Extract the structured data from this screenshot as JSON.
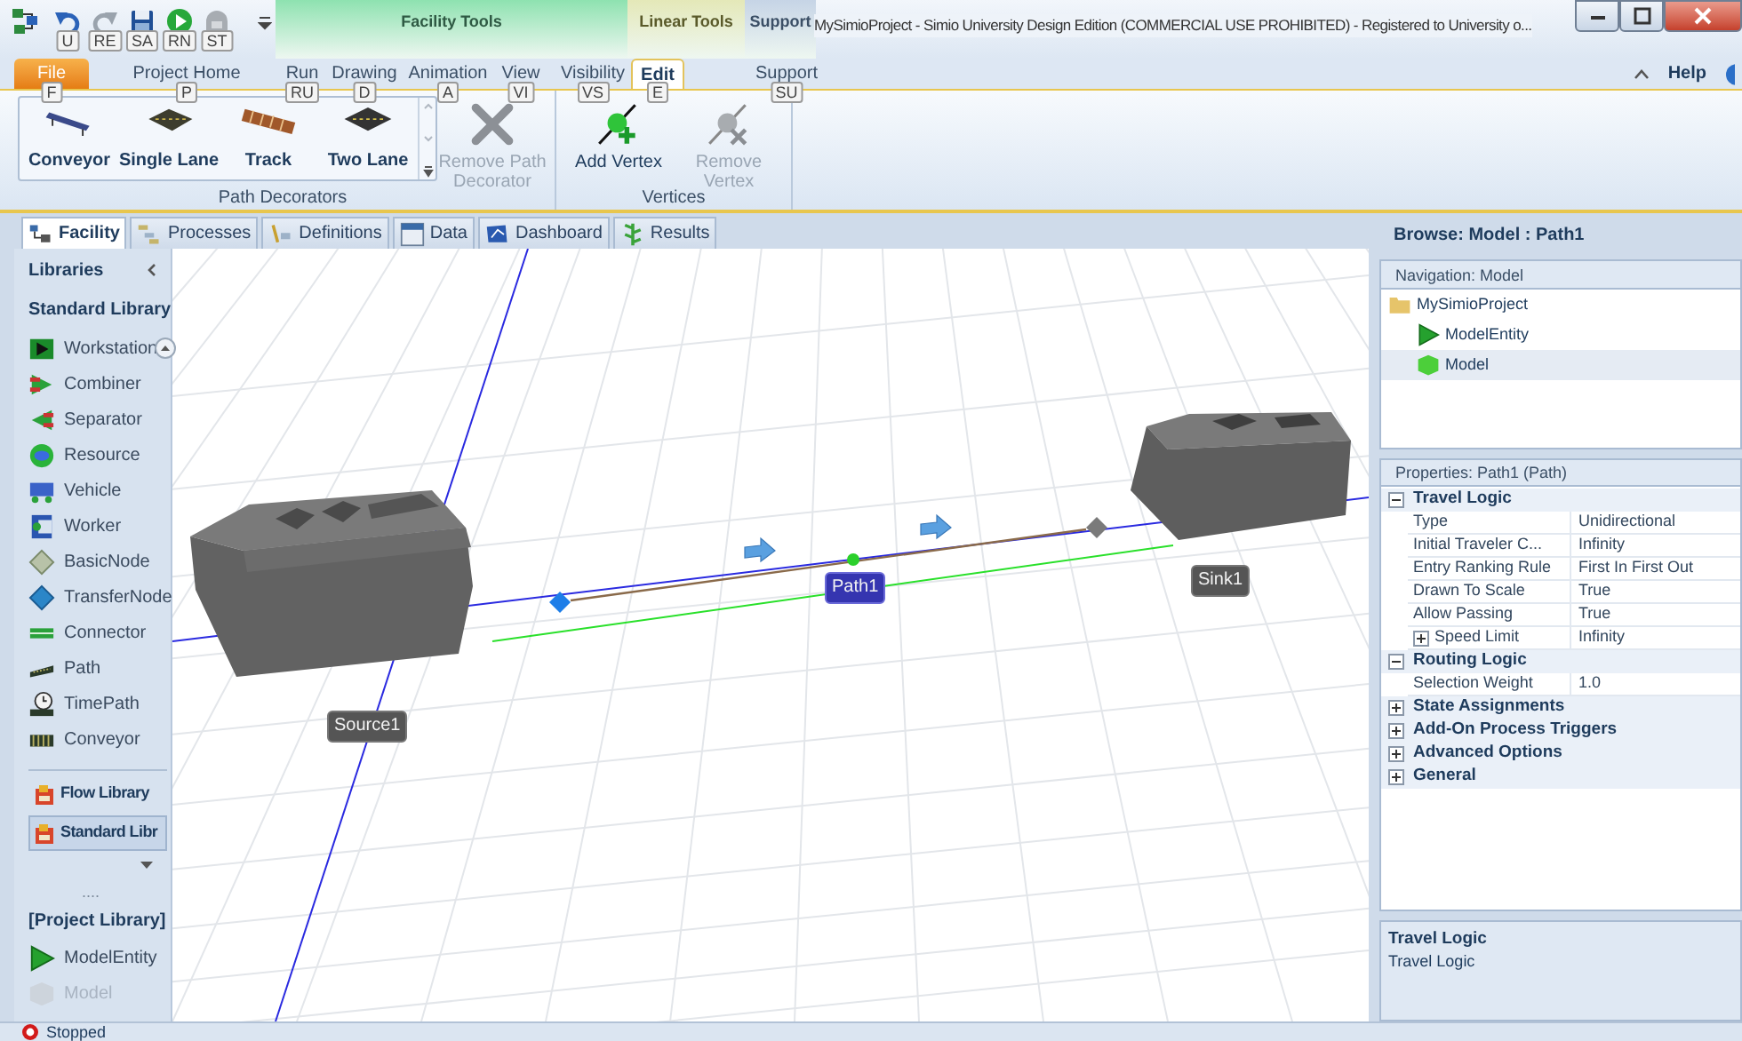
{
  "title_bar": {
    "quick_access": [
      {
        "kind": "undo",
        "key_tip": "U"
      },
      {
        "kind": "redo",
        "key_tip": "RE"
      },
      {
        "kind": "save",
        "key_tip": "SA"
      },
      {
        "kind": "run",
        "key_tip": "RN"
      },
      {
        "kind": "stop",
        "key_tip": "ST"
      }
    ],
    "context_groups": [
      {
        "label": "Facility Tools",
        "color": "#8ee2b0"
      },
      {
        "label": "Linear Tools",
        "color": "#e4e8b8"
      },
      {
        "label": "Support",
        "color": "#c6d4e6"
      }
    ],
    "title": "MySimioProject - Simio University Design Edition (COMMERCIAL USE PROHIBITED) - Registered to University o..."
  },
  "ribbon_tabs": [
    {
      "label": "File",
      "key_tip": "F",
      "kind": "file",
      "selected": false
    },
    {
      "label": "Project Home",
      "key_tip": "P",
      "kind": "tab",
      "selected": false
    },
    {
      "label": "Run",
      "key_tip": "RU",
      "kind": "tab",
      "selected": false
    },
    {
      "label": "Drawing",
      "key_tip": "D",
      "kind": "tab",
      "selected": false
    },
    {
      "label": "Animation",
      "key_tip": "A",
      "kind": "tab",
      "selected": false
    },
    {
      "label": "View",
      "key_tip": "VI",
      "kind": "tab",
      "selected": false
    },
    {
      "label": "Visibility",
      "key_tip": "VS",
      "kind": "tab",
      "selected": false
    },
    {
      "label": "Edit",
      "key_tip": "E",
      "kind": "tab",
      "selected": true
    },
    {
      "label": "Support",
      "key_tip": "SU",
      "kind": "tab",
      "selected": false
    }
  ],
  "help": "Help",
  "ribbon_groups": [
    {
      "label": "Path Decorators",
      "gallery": [
        {
          "label": "Conveyor",
          "kind": "conveyor"
        },
        {
          "label": "Single Lane",
          "kind": "single_lane"
        },
        {
          "label": "Track",
          "kind": "track"
        },
        {
          "label": "Two Lane",
          "kind": "two_lane"
        }
      ],
      "buttons": [
        {
          "label": "Remove Path Decorator",
          "kind": "remove_decorator",
          "disabled": true
        }
      ]
    },
    {
      "label": "Vertices",
      "buttons": [
        {
          "label": "Add Vertex",
          "kind": "add_vertex",
          "disabled": false
        },
        {
          "label": "Remove Vertex",
          "kind": "remove_vertex",
          "disabled": true
        }
      ]
    }
  ],
  "view_tabs": [
    {
      "label": "Facility",
      "kind": "facility",
      "selected": true
    },
    {
      "label": "Processes",
      "kind": "processes",
      "selected": false
    },
    {
      "label": "Definitions",
      "kind": "definitions",
      "selected": false
    },
    {
      "label": "Data",
      "kind": "data",
      "selected": false
    },
    {
      "label": "Dashboard",
      "kind": "dashboard",
      "selected": false
    },
    {
      "label": "Results",
      "kind": "results",
      "selected": false
    }
  ],
  "libraries": {
    "title": "Libraries",
    "heading": "Standard Library",
    "items": [
      {
        "label": "Workstation",
        "kind": "workstation"
      },
      {
        "label": "Combiner",
        "kind": "combiner"
      },
      {
        "label": "Separator",
        "kind": "separator"
      },
      {
        "label": "Resource",
        "kind": "resource"
      },
      {
        "label": "Vehicle",
        "kind": "vehicle"
      },
      {
        "label": "Worker",
        "kind": "worker"
      },
      {
        "label": "BasicNode",
        "kind": "basicnode"
      },
      {
        "label": "TransferNode",
        "kind": "transfernode"
      },
      {
        "label": "Connector",
        "kind": "connector"
      },
      {
        "label": "Path",
        "kind": "path"
      },
      {
        "label": "TimePath",
        "kind": "timepath"
      },
      {
        "label": "Conveyor",
        "kind": "conveyor"
      }
    ],
    "library_buttons": [
      {
        "label": "Flow Library",
        "selected": false
      },
      {
        "label": "Standard Libr",
        "selected": true
      }
    ],
    "more": "....",
    "project_heading": "[Project Library]",
    "project_items": [
      {
        "label": "ModelEntity",
        "kind": "entity",
        "disabled": false
      },
      {
        "label": "Model",
        "kind": "model",
        "disabled": true
      }
    ]
  },
  "canvas": {
    "objects": [
      {
        "label": "Source1",
        "kind": "source",
        "selected": false
      },
      {
        "label": "Path1",
        "kind": "path",
        "selected": true
      },
      {
        "label": "Sink1",
        "kind": "sink",
        "selected": false
      }
    ]
  },
  "browser": {
    "title": "Browse: Model : Path1",
    "navigation": {
      "header": "Navigation: Model",
      "tree": [
        {
          "label": "MySimioProject",
          "kind": "project",
          "selected": false,
          "children": [
            {
              "label": "ModelEntity",
              "kind": "entity",
              "selected": false
            },
            {
              "label": "Model",
              "kind": "model",
              "selected": true
            }
          ]
        }
      ]
    },
    "properties": {
      "header": "Properties: Path1 (Path)",
      "categories": [
        {
          "label": "Travel Logic",
          "expanded": true,
          "rows": [
            {
              "label": "Type",
              "value": "Unidirectional",
              "kind": "value"
            },
            {
              "label": "Initial Traveler C...",
              "value": "Infinity",
              "kind": "value"
            },
            {
              "label": "Entry Ranking Rule",
              "value": "First In First Out",
              "kind": "value"
            },
            {
              "label": "Drawn To Scale",
              "value": "True",
              "kind": "value"
            },
            {
              "label": "Allow Passing",
              "value": "True",
              "kind": "value"
            },
            {
              "label": "Speed Limit",
              "value": "Infinity",
              "kind": "group",
              "expanded": false
            }
          ]
        },
        {
          "label": "Routing Logic",
          "expanded": true,
          "rows": [
            {
              "label": "Selection Weight",
              "value": "1.0",
              "kind": "value"
            }
          ]
        },
        {
          "label": "State Assignments",
          "expanded": false
        },
        {
          "label": "Add-On Process Triggers",
          "expanded": false
        },
        {
          "label": "Advanced Options",
          "expanded": false
        },
        {
          "label": "General",
          "expanded": false
        }
      ]
    },
    "description": {
      "title": "Travel Logic",
      "text": "Travel Logic"
    }
  },
  "status_bar": {
    "state": "Stopped"
  }
}
